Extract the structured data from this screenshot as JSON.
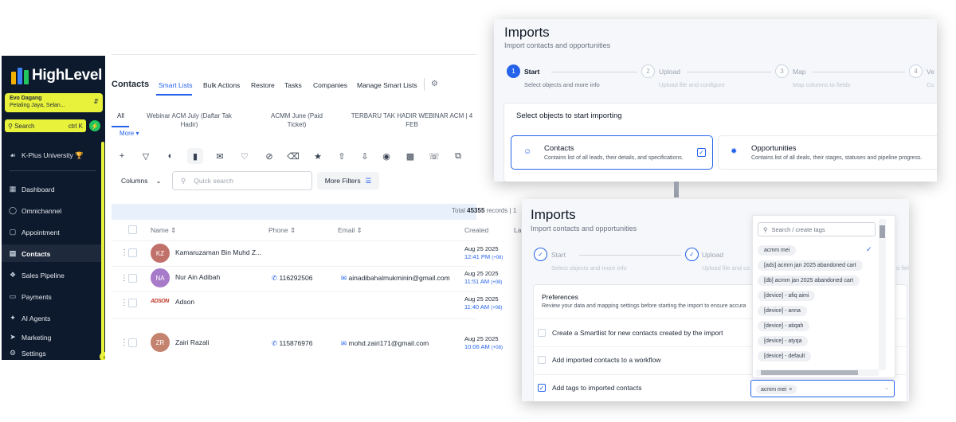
{
  "sidebar": {
    "logo": "HighLevel",
    "location_name": "Evo Dagang",
    "location_sub": "Petaling Jaya, Selan...",
    "search_label": "Search",
    "search_shortcut": "ctrl K",
    "university": "K-Plus University 🏆",
    "items": [
      {
        "label": "Dashboard",
        "icon": "grid-icon"
      },
      {
        "label": "Omnichannel",
        "icon": "chat-icon"
      },
      {
        "label": "Appointment",
        "icon": "calendar-icon"
      },
      {
        "label": "Contacts",
        "icon": "contacts-icon"
      },
      {
        "label": "Sales Pipeline",
        "icon": "pipeline-icon"
      },
      {
        "label": "Payments",
        "icon": "payments-icon"
      },
      {
        "label": "AI Agents",
        "icon": "sparkle-icon"
      },
      {
        "label": "Marketing",
        "icon": "send-icon"
      },
      {
        "label": "Settings",
        "icon": "gear-icon"
      }
    ],
    "active": "Contacts",
    "brand_yellow": "#e9f23a",
    "bg": "#0d1a2e"
  },
  "nav": {
    "title": "Contacts",
    "tabs": [
      "Smart Lists",
      "Bulk Actions",
      "Restore",
      "Tasks",
      "Companies",
      "Manage Smart Lists"
    ]
  },
  "smart_lists": {
    "all": "All",
    "items": [
      "Webinar ACM July (Daftar Tak Hadir)",
      "ACMM June (Paid Ticket)",
      "TERBARU TAK HADIR WEBINAR ACM | 4 FEB"
    ],
    "more": "More ▾"
  },
  "toolbar": {
    "columns": "Columns",
    "quick_search": "Quick search",
    "more_filters": "More Filters"
  },
  "table": {
    "total_prefix": "Total",
    "total_count": "45355",
    "total_suffix": "records | 1",
    "headers": [
      "Name",
      "Phone",
      "Email",
      "Created",
      "La"
    ],
    "rows": [
      {
        "initials": "KZ",
        "color": "#c0726a",
        "name": "Kamaruzaman Bin Muhd Z...",
        "phone": "",
        "email": "",
        "date": "Aug 25 2025",
        "time": "12:41 PM",
        "tz": "(+08)"
      },
      {
        "initials": "NA",
        "color": "#a77bc9",
        "name": "Nur Ain Adibah",
        "phone": "116292506",
        "email": "ainadibahalmukminin@gmail.com",
        "date": "Aug 25 2025",
        "time": "11:51 AM",
        "tz": "(+08)"
      },
      {
        "initials": "ADSON",
        "color": "",
        "name": "Adson",
        "phone": "",
        "email": "",
        "date": "Aug 25 2025",
        "time": "11:40 AM",
        "tz": "(+08)"
      },
      {
        "initials": "ZR",
        "color": "#c4836f",
        "name": "Zairi Razali",
        "phone": "115876976",
        "email": "mohd.zairi171@gmail.com",
        "date": "Aug 25 2025",
        "time": "10:06 AM",
        "tz": "(+08)"
      }
    ]
  },
  "imports1": {
    "title": "Imports",
    "subtitle": "Import contacts and opportunities",
    "steps": [
      {
        "num": "1",
        "label": "Start",
        "desc": "Select objects and more info"
      },
      {
        "num": "2",
        "label": "Upload",
        "desc": "Upload file and configure"
      },
      {
        "num": "3",
        "label": "Map",
        "desc": "Map columns to fields"
      },
      {
        "num": "4",
        "label": "Ve",
        "desc": "Co"
      }
    ],
    "select_heading": "Select objects to start importing",
    "objects": [
      {
        "title": "Contacts",
        "desc": "Contains list of all leads, their details, and specifications."
      },
      {
        "title": "Opportunities",
        "desc": "Contains list of all deals, their stages, statuses and pipeline progress."
      }
    ]
  },
  "imports2": {
    "title": "Imports",
    "subtitle": "Import contacts and opportunities",
    "steps": [
      {
        "label": "Start",
        "desc": "Select objects and more info"
      },
      {
        "label": "Upload",
        "desc": "Upload file and co"
      }
    ],
    "step_tail": "o fiel",
    "pref_title": "Preferences",
    "pref_desc": "Review your data and mapping settings before starting the import to ensure accura",
    "options": [
      {
        "label": "Create a Smartlist for new contacts created by the import",
        "checked": false
      },
      {
        "label": "Add imported contacts to a workflow",
        "checked": false
      },
      {
        "label": "Add tags to imported contacts",
        "checked": true
      }
    ],
    "tag_search_placeholder": "Search / create tags",
    "tags": [
      "acmm mei",
      "[ads] acmm jan 2025 abandoned cart",
      "[db] acmm jan 2025 abandoned cart",
      "[device] - afiq aimi",
      "[device] - anna",
      "[device] - atiqah",
      "[device] - atyqa",
      "[device] - default"
    ],
    "selected_tag": "acmm mei"
  }
}
